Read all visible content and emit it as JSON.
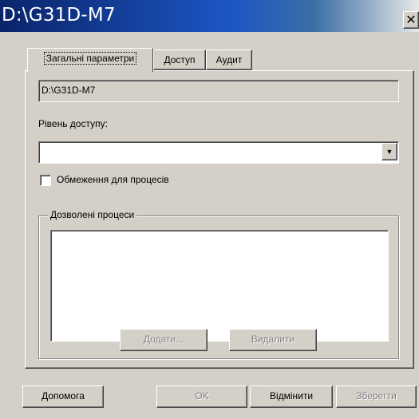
{
  "window": {
    "title": "D:\\G31D-M7",
    "close_glyph": "✕"
  },
  "tabs": [
    {
      "label": "Загальні параметри",
      "active": true
    },
    {
      "label": "Доступ",
      "active": false
    },
    {
      "label": "Аудит",
      "active": false
    }
  ],
  "general": {
    "path_value": "D:\\G31D-M7",
    "access_level_label": "Рівень доступу:",
    "access_level_value": "",
    "restrict_checkbox_label": "Обмеження для процесів",
    "restrict_checked": false,
    "allowed_processes_label": "Дозволені процеси",
    "allowed_processes": [],
    "add_button": "Додати...",
    "remove_button": "Видалити"
  },
  "footer": {
    "help_button": "Допомога",
    "ok_button": "OK",
    "cancel_button": "Відмінити",
    "save_button": "Зберегти"
  },
  "icons": {
    "close": "close-icon",
    "dropdown": "chevron-down-icon"
  }
}
